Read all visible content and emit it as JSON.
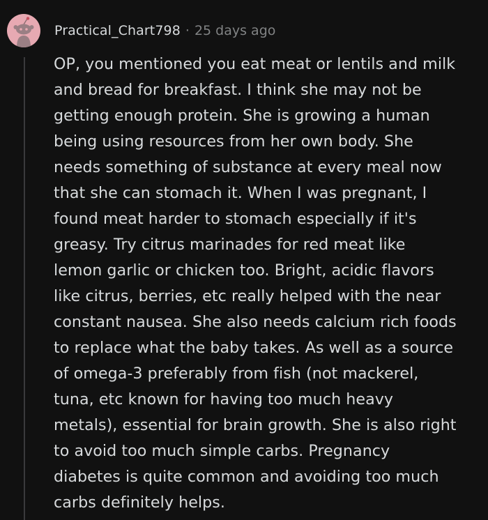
{
  "comment": {
    "author": "Practical_Chart798",
    "separator": "·",
    "timestamp": "25 days ago",
    "avatar_icon": "snoo-avatar-icon",
    "body_lines": [
      "OP, you mentioned you eat meat or lentils and milk",
      "and bread for breakfast. I think she may not be",
      "getting enough protein. She is growing a human",
      "being using resources from her own body. She",
      "needs something of substance at every meal now",
      "that she can stomach it. When I was pregnant, I",
      "found meat harder to stomach especially if it's",
      "greasy. Try citrus marinades for red meat like",
      "lemon garlic or chicken too. Bright, acidic flavors",
      "like citrus, berries, etc really helped with the near",
      "constant nausea. She also needs calcium rich foods",
      "to replace what the baby takes. As well as a source",
      "of omega-3 preferably from fish (not mackerel,",
      "tuna, etc known for having too much heavy",
      "metals), essential for brain growth. She is also right",
      "to avoid too much simple carbs. Pregnancy",
      "diabetes is quite common and avoiding too much",
      "carbs definitely helps."
    ]
  },
  "colors": {
    "background": "#111111",
    "text": "#d7dadc",
    "meta": "#818384",
    "avatar_bg": "#e7a9b2",
    "thread_line": "#3a3a3c"
  }
}
